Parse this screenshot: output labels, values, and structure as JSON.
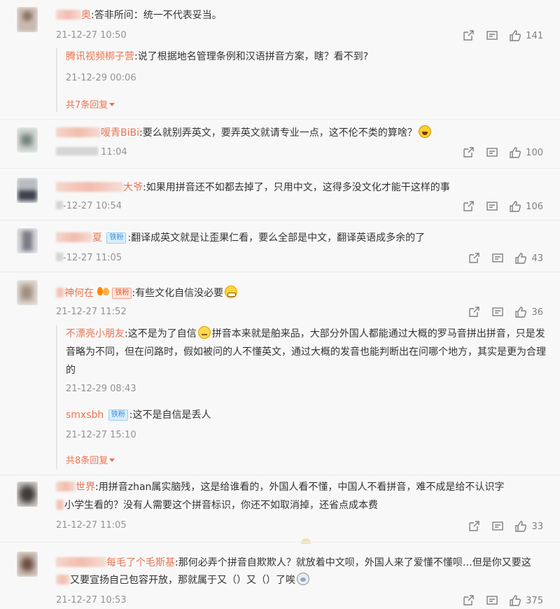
{
  "comments": [
    {
      "id": "c1",
      "name_visible": "奥",
      "text": ":答非所问：统一不代表妥当。",
      "time_visible": "21-12-27 10:50",
      "likes": "141",
      "replies": [
        {
          "name": "腾讯视频梆子营",
          "text": ":说了根据地名管理条例和汉语拼音方案，瞎？看不到?",
          "time": "21-12-29 00:06"
        }
      ],
      "more_label": "共7条回复"
    },
    {
      "id": "c2",
      "name_visible": "嗳青BiBi",
      "text": ":要么就别弄英文，要弄英文就请专业一点，这不伦不类的算啥？",
      "time_visible": "11:04",
      "likes": "100"
    },
    {
      "id": "c3",
      "name_visible": "大爷",
      "text": ":如果用拼音还不如都去掉了，只用中文，这得多没文化才能干这样的事",
      "time_visible": "-12-27 10:54",
      "likes": "106"
    },
    {
      "id": "c4",
      "name_visible": "夏",
      "badge": "铁粉",
      "text": ":翻译成英文就是让歪果仁看，要么全部是中文，翻译英语成多余的了",
      "time_visible": "-12-27 11:05",
      "likes": "43"
    },
    {
      "id": "c5",
      "name_visible": "神何在",
      "badge": "铁粉",
      "text": ":有些文化自信没必要",
      "time_visible": "21-12-27 11:52",
      "likes": "36",
      "replies": [
        {
          "name": "不漂亮小朋友",
          "text_a": ":这不是为了自信",
          "text_b": "拼音本来就是舶来品，大部分外国人都能通过大概的罗马音拼出拼音，只是发音略为不同，但在问路时，假如被问的人不懂英文，通过大概的发音也能判断出在问哪个地方，其实是更为合理的",
          "time": "21-12-29 08:43"
        },
        {
          "name": "smxsbh",
          "badge": "铁粉",
          "text": ":这不是自信是丢人",
          "time": "21-12-27 15:10"
        }
      ],
      "more_label": "共8条回复"
    },
    {
      "id": "c6",
      "name_visible": "世界",
      "text_line1": ":用拼音zhan属实脑残，这是给谁看的，外国人看不懂，中国人不看拼音，难不成是给不认识字",
      "text_line2": "小学生看的？没有人需要这个拼音标识，你还不如取消掉，还省点成本费",
      "time_visible": "21-12-27 11:05",
      "likes": "33"
    },
    {
      "id": "c7",
      "name_visible": "每毛了个毛斯基",
      "text_line1": ":那何必弄个拼音自欺欺人？就放着中文呗，外国人来了爱懂不懂呗…但是你又要这",
      "text_line2": "又要宣扬自己包容开放，那就属于又（）又（）了唉",
      "time_visible": "21-12-27 10:53",
      "likes": "375"
    }
  ],
  "icons": {
    "share": "share-icon",
    "comment": "comment-icon",
    "like": "thumbs-up-icon"
  },
  "colors": {
    "username": "#eb7350",
    "timestamp": "#939393",
    "background": "#f8f8f8"
  }
}
